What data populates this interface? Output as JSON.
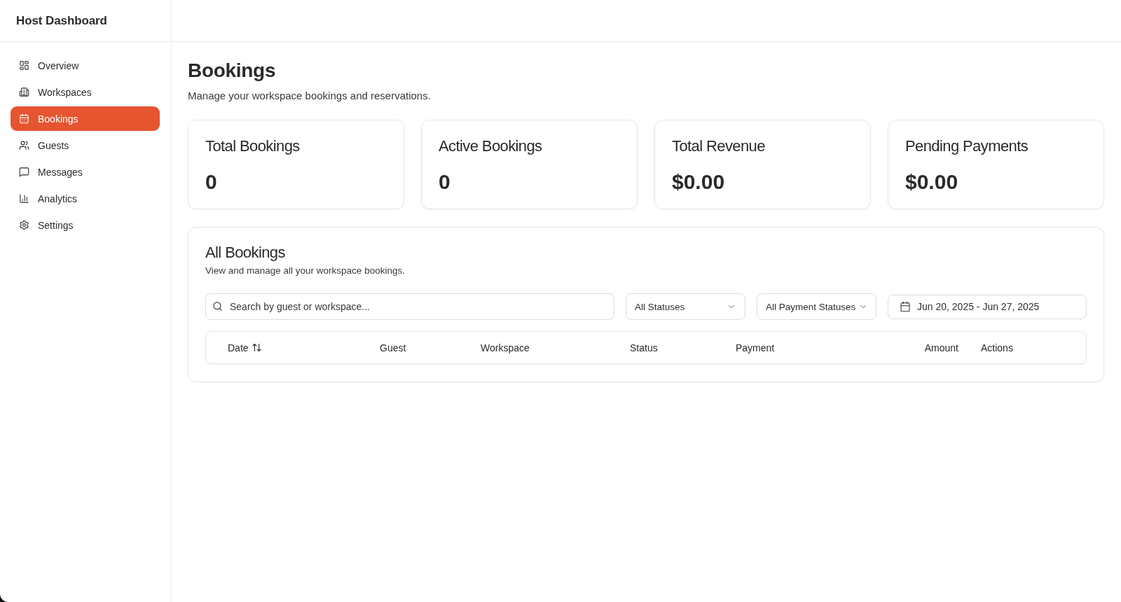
{
  "sidebar": {
    "title": "Host Dashboard",
    "items": [
      {
        "label": "Overview",
        "selected": false
      },
      {
        "label": "Workspaces",
        "selected": false
      },
      {
        "label": "Bookings",
        "selected": true
      },
      {
        "label": "Guests",
        "selected": false
      },
      {
        "label": "Messages",
        "selected": false
      },
      {
        "label": "Analytics",
        "selected": false
      },
      {
        "label": "Settings",
        "selected": false
      }
    ]
  },
  "page": {
    "title": "Bookings",
    "subtitle": "Manage your workspace bookings and reservations."
  },
  "stats": [
    {
      "label": "Total Bookings",
      "value": "0"
    },
    {
      "label": "Active Bookings",
      "value": "0"
    },
    {
      "label": "Total Revenue",
      "value": "$0.00"
    },
    {
      "label": "Pending Payments",
      "value": "$0.00"
    }
  ],
  "bookings_panel": {
    "title": "All Bookings",
    "subtitle": "View and manage all your workspace bookings.",
    "search": {
      "placeholder": "Search by guest or workspace..."
    },
    "filters": [
      {
        "kind": "select",
        "value": "All Statuses"
      },
      {
        "kind": "select",
        "value": "All Payment Statuses"
      },
      {
        "kind": "date_range",
        "value": "Jun 20, 2025 - Jun 27, 2025"
      }
    ],
    "table": {
      "columns": [
        {
          "label": "Date",
          "sortable": true
        },
        {
          "label": "Guest",
          "sortable": false
        },
        {
          "label": "Workspace",
          "sortable": false
        },
        {
          "label": "Status",
          "sortable": false
        },
        {
          "label": "Payment",
          "sortable": false
        },
        {
          "label": "Amount",
          "sortable": false
        },
        {
          "label": "Actions",
          "sortable": false
        }
      ]
    }
  }
}
